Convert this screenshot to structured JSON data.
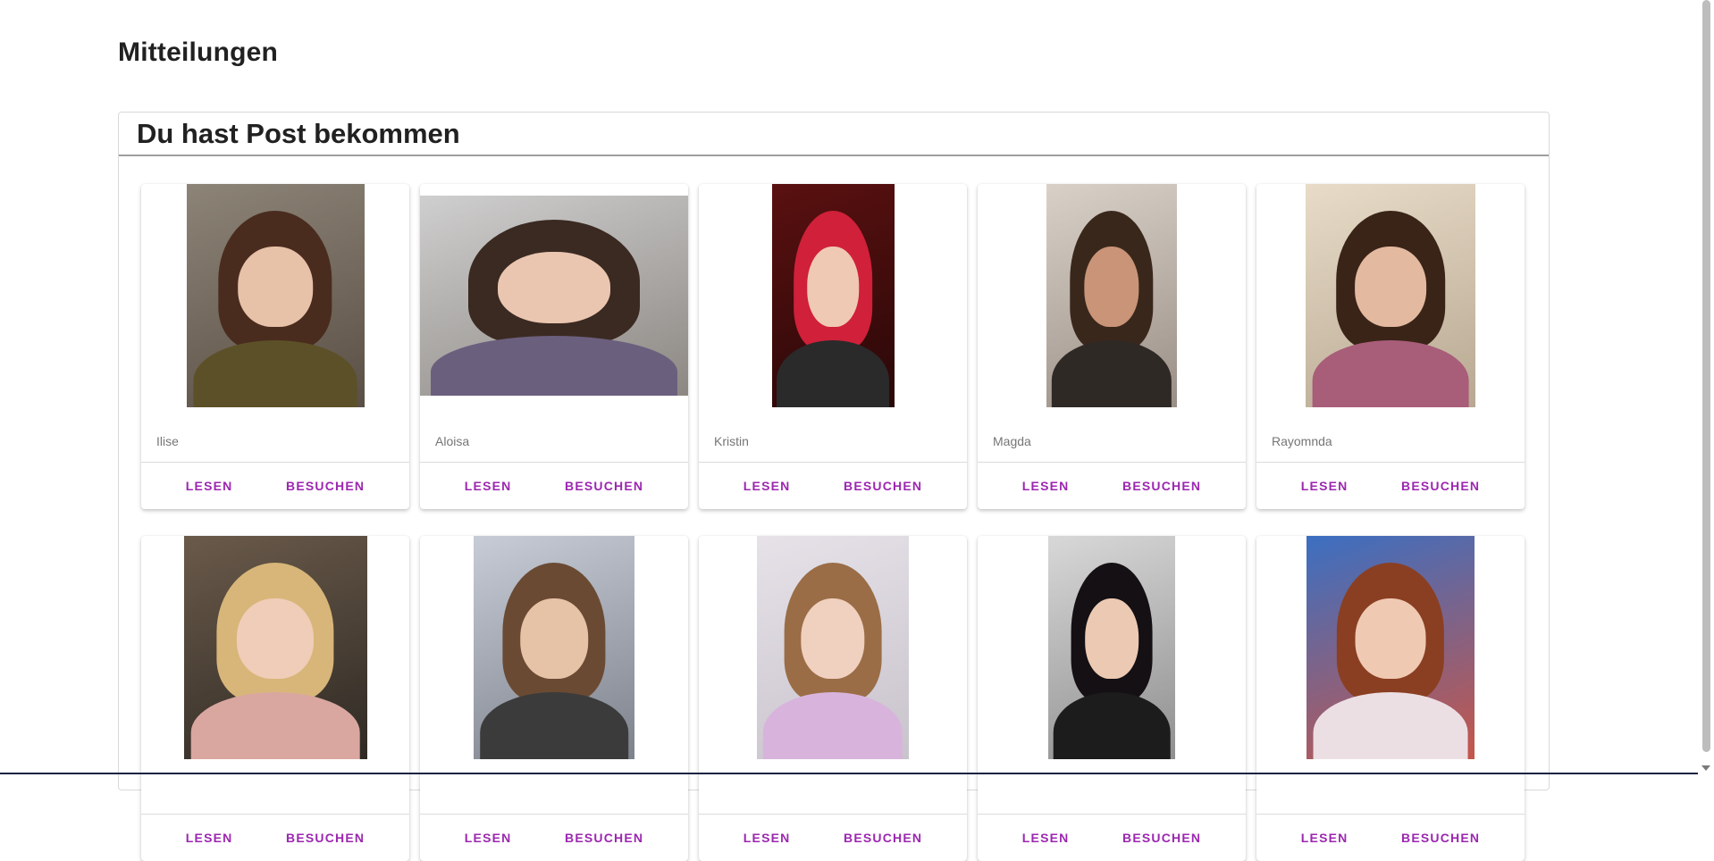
{
  "page": {
    "title": "Mitteilungen"
  },
  "panel": {
    "title": "Du hast Post bekommen"
  },
  "actions": {
    "read_label": "LESEN",
    "visit_label": "BESUCHEN"
  },
  "colors": {
    "accent": "#9c27b0",
    "header_rule": "#9e9e9e"
  },
  "messages": [
    {
      "name": "Ilise"
    },
    {
      "name": "Aloisa"
    },
    {
      "name": "Kristin"
    },
    {
      "name": "Magda"
    },
    {
      "name": "Rayomnda"
    },
    {
      "name": ""
    },
    {
      "name": ""
    },
    {
      "name": ""
    },
    {
      "name": ""
    },
    {
      "name": ""
    }
  ]
}
